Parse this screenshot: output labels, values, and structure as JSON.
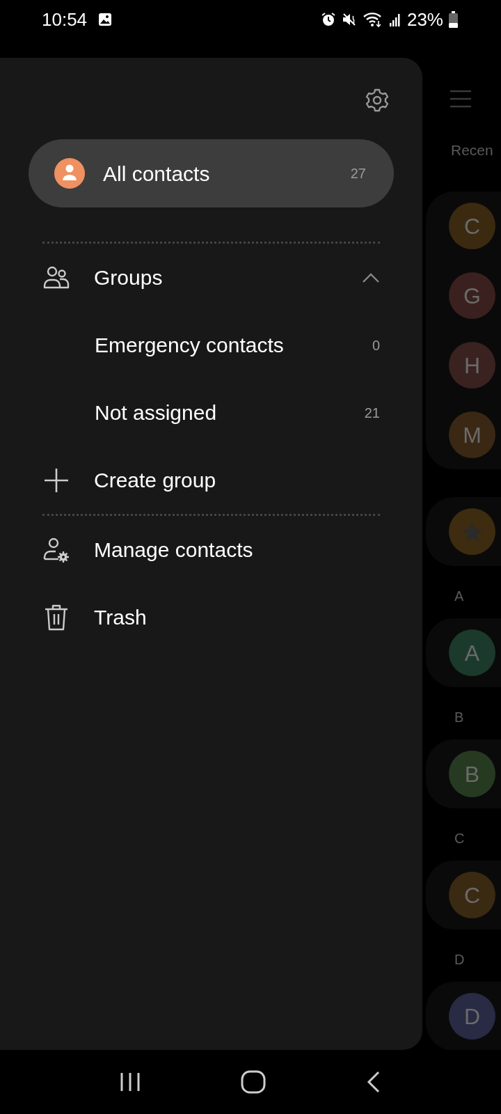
{
  "status_bar": {
    "time": "10:54",
    "battery": "23%"
  },
  "drawer": {
    "all_contacts": {
      "label": "All contacts",
      "count": "27",
      "selected": true
    },
    "groups": {
      "label": "Groups",
      "expanded": true,
      "items": [
        {
          "label": "Emergency contacts",
          "count": "0"
        },
        {
          "label": "Not assigned",
          "count": "21"
        }
      ]
    },
    "actions": [
      {
        "kind": "create",
        "label": "Create group"
      },
      {
        "kind": "divider"
      },
      {
        "kind": "manage",
        "label": "Manage contacts"
      },
      {
        "kind": "trash",
        "label": "Trash"
      }
    ]
  },
  "background": {
    "section_label": "Recen",
    "recent": [
      {
        "letter": "C",
        "color": "#3b2a10"
      },
      {
        "letter": "G",
        "color": "#3a201e"
      },
      {
        "letter": "H",
        "color": "#3a2220"
      },
      {
        "letter": "M",
        "color": "#3a2814"
      }
    ],
    "favorites": {
      "color": "#3d2c10"
    },
    "sections": [
      {
        "letter": "A",
        "avatar": "A",
        "color": "#1b3a2b"
      },
      {
        "letter": "B",
        "avatar": "B",
        "color": "#263a22"
      },
      {
        "letter": "C",
        "avatar": "C",
        "color": "#3a2a12"
      },
      {
        "letter": "D",
        "avatar": "D",
        "color": "#292b45"
      }
    ]
  }
}
